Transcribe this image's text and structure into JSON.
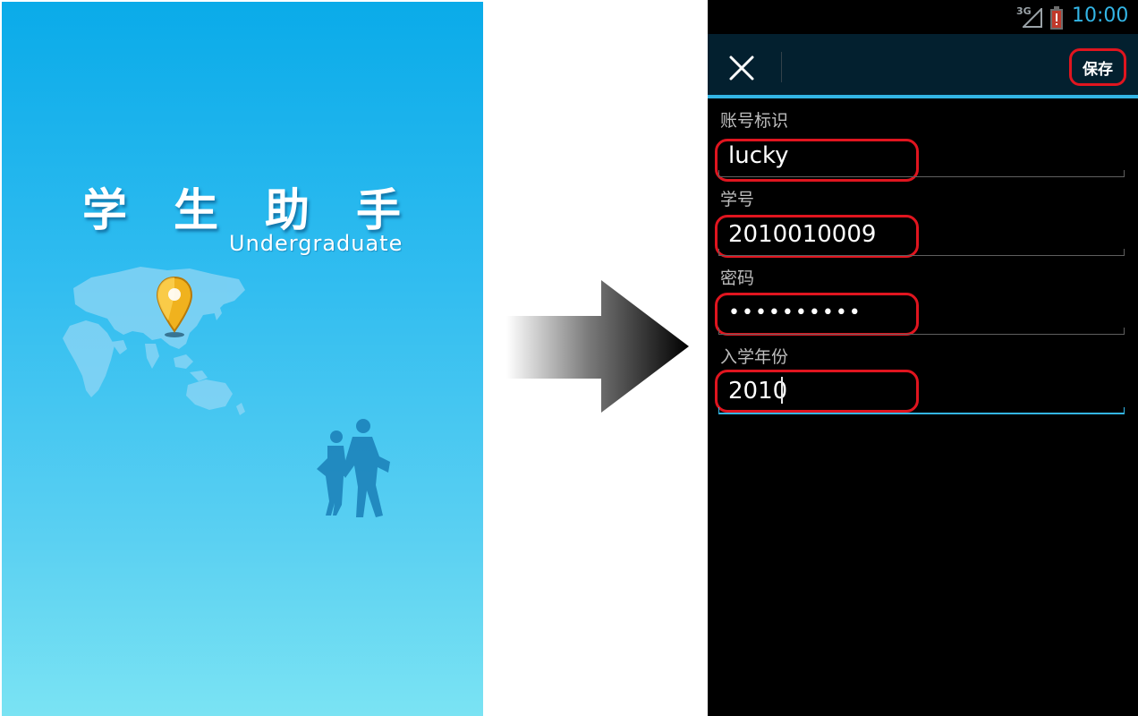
{
  "splash": {
    "title_chars": [
      "学",
      "生",
      "助",
      "手"
    ],
    "subtitle": "Undergraduate",
    "background_top": "#0aabe9",
    "background_bottom": "#7ae3f3"
  },
  "status_bar": {
    "network": "3G",
    "time": "10:00",
    "time_color": "#33b5e5"
  },
  "action_bar": {
    "close_icon": "close-icon",
    "save_label": "保存",
    "accent": "#33b5e5"
  },
  "form": {
    "account_id_label": "账号标识",
    "account_id_value": "lucky",
    "student_id_label": "学号",
    "student_id_value": "2010010009",
    "password_label": "密码",
    "password_value": "••••••••••",
    "enroll_year_label": "入学年份",
    "enroll_year_value": "2010"
  },
  "highlight_color": "#e0151f"
}
